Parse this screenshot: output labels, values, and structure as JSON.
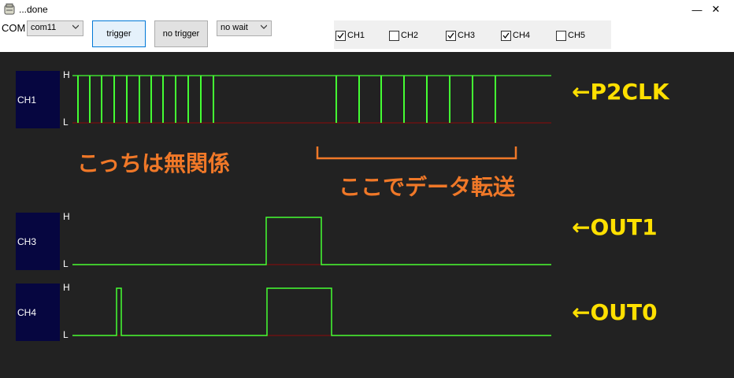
{
  "window": {
    "title": "...done",
    "minimize": "—",
    "close": "✕"
  },
  "toolbar": {
    "com_label": "COM",
    "port_select": "com11",
    "trigger_button": "trigger",
    "no_trigger_button": "no trigger",
    "wait_select": "no wait"
  },
  "channels_checkboxes": [
    {
      "label": "CH1",
      "checked": true
    },
    {
      "label": "CH2",
      "checked": false
    },
    {
      "label": "CH3",
      "checked": true
    },
    {
      "label": "CH4",
      "checked": true
    },
    {
      "label": "CH5",
      "checked": false
    }
  ],
  "scope": {
    "high_label": "H",
    "low_label": "L",
    "traces": [
      {
        "channel": "CH1",
        "signal": "P2CLK"
      },
      {
        "channel": "CH3",
        "signal": "OUT1"
      },
      {
        "channel": "CH4",
        "signal": "OUT0"
      }
    ]
  },
  "annotations": {
    "ch1_arrow": "←P2CLK",
    "ch3_arrow": "←OUT1",
    "ch4_arrow": "←OUT0",
    "unrelated": "こっちは無関係",
    "transfer": "ここでデータ転送"
  },
  "colors": {
    "trace": "#44ff33",
    "low_line": "#7a1010",
    "label_bg": "#060640",
    "scope_bg": "#222222"
  }
}
